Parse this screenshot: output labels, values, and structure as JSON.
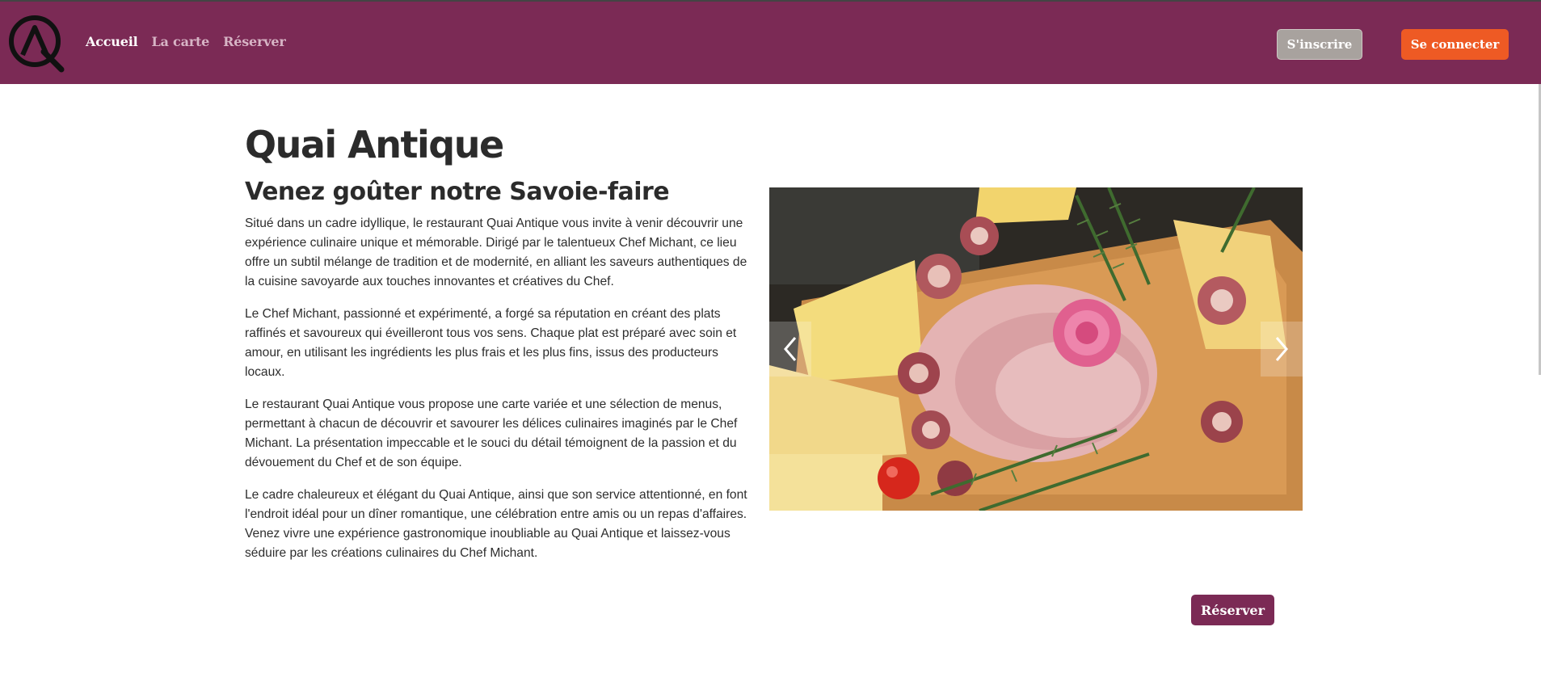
{
  "nav": {
    "logo": "Quai Antique logo",
    "links": [
      {
        "label": "Accueil",
        "active": true
      },
      {
        "label": "La carte",
        "active": false
      },
      {
        "label": "Réserver",
        "active": false
      }
    ],
    "signup_label": "S'inscrire",
    "login_label": "Se connecter"
  },
  "hero": {
    "title": "Quai Antique",
    "subtitle": "Venez goûter notre Savoie-faire",
    "paragraphs": [
      "Situé dans un cadre idyllique, le restaurant Quai Antique vous invite à venir découvrir une expérience culinaire unique et mémorable. Dirigé par le talentueux Chef Michant, ce lieu offre un subtil mélange de tradition et de modernité, en alliant les saveurs authentiques de la cuisine savoyarde aux touches innovantes et créatives du Chef.",
      "Le Chef Michant, passionné et expérimenté, a forgé sa réputation en créant des plats raffinés et savoureux qui éveilleront tous vos sens. Chaque plat est préparé avec soin et amour, en utilisant les ingrédients les plus frais et les plus fins, issus des producteurs locaux.",
      "Le restaurant Quai Antique vous propose une carte variée et une sélection de menus, permettant à chacun de découvrir et savourer les délices culinaires imaginés par le Chef Michant. La présentation impeccable et le souci du détail témoignent de la passion et du dévouement du Chef et de son équipe.",
      "Le cadre chaleureux et élégant du Quai Antique, ainsi que son service attentionné, en font l'endroit idéal pour un dîner romantique, une célébration entre amis ou un repas d'affaires. Venez vivre une expérience gastronomique inoubliable au Quai Antique et laissez-vous séduire par les créations culinaires du Chef Michant."
    ]
  },
  "carousel": {
    "image": "charcuterie board with cheese, rolled ham, rose and rosemary",
    "prev_icon": "chevron-left-icon",
    "next_icon": "chevron-right-icon"
  },
  "cta": {
    "reserve_label": "Réserver"
  },
  "colors": {
    "brand": "#7b2a55",
    "login": "#ee5a24",
    "signup": "#a8a29e"
  }
}
